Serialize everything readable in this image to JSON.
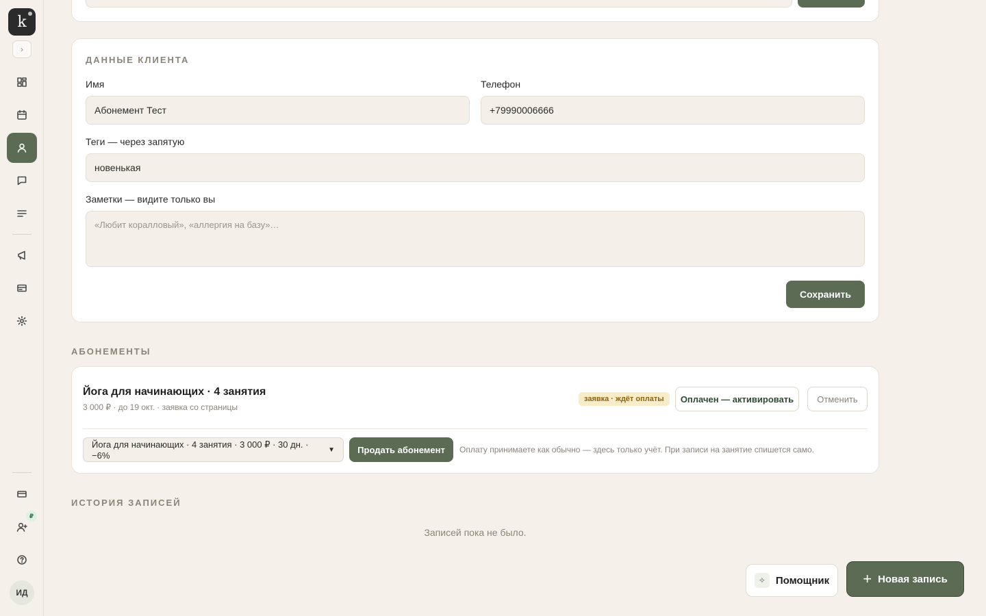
{
  "sidebar": {
    "logo_letter": "k",
    "avatar_initials": "ИД",
    "badge_symbol": "₽",
    "icons": [
      "dashboard-icon",
      "calendar-icon",
      "user-icon",
      "chat-icon",
      "list-icon",
      "megaphone-icon",
      "card-icon",
      "gear-icon",
      "credit-card-icon",
      "add-user-icon",
      "help-icon"
    ],
    "active_item": "user-icon"
  },
  "client_section": {
    "title": "ДАННЫЕ КЛИЕНТА",
    "name_label": "Имя",
    "name_value": "Абонемент Тест",
    "phone_label": "Телефон",
    "phone_value": "+79990006666",
    "tags_label": "Теги — через запятую",
    "tags_value": "новенькая",
    "notes_label": "Заметки — видите только вы",
    "notes_placeholder": "«Любит коралловый», «аллергия на базу»…",
    "save_label": "Сохранить"
  },
  "subscriptions": {
    "title": "АБОНЕМЕНТЫ",
    "item": {
      "name": "Йога для начинающих · 4 занятия",
      "details": "3 000 ₽ · до 19 окт. · заявка со страницы",
      "status": "заявка · ждёт оплаты",
      "activate_label": "Оплачен — активировать",
      "cancel_label": "Отменить"
    },
    "select_value": "Йога для начинающих · 4 занятия · 3 000 ₽ · 30 дн. · −6%",
    "sell_label": "Продать абонемент",
    "hint": "Оплату принимаете как обычно — здесь только учёт. При записи на занятие спишется само."
  },
  "history": {
    "title": "ИСТОРИЯ ЗАПИСЕЙ",
    "empty_text": "Записей пока не было."
  },
  "floating": {
    "assistant_label": "Помощник",
    "new_booking_label": "Новая запись"
  },
  "colors": {
    "accent": "#5b6b54",
    "background": "#f5f1ea",
    "status_bg": "#f8ecc9"
  }
}
